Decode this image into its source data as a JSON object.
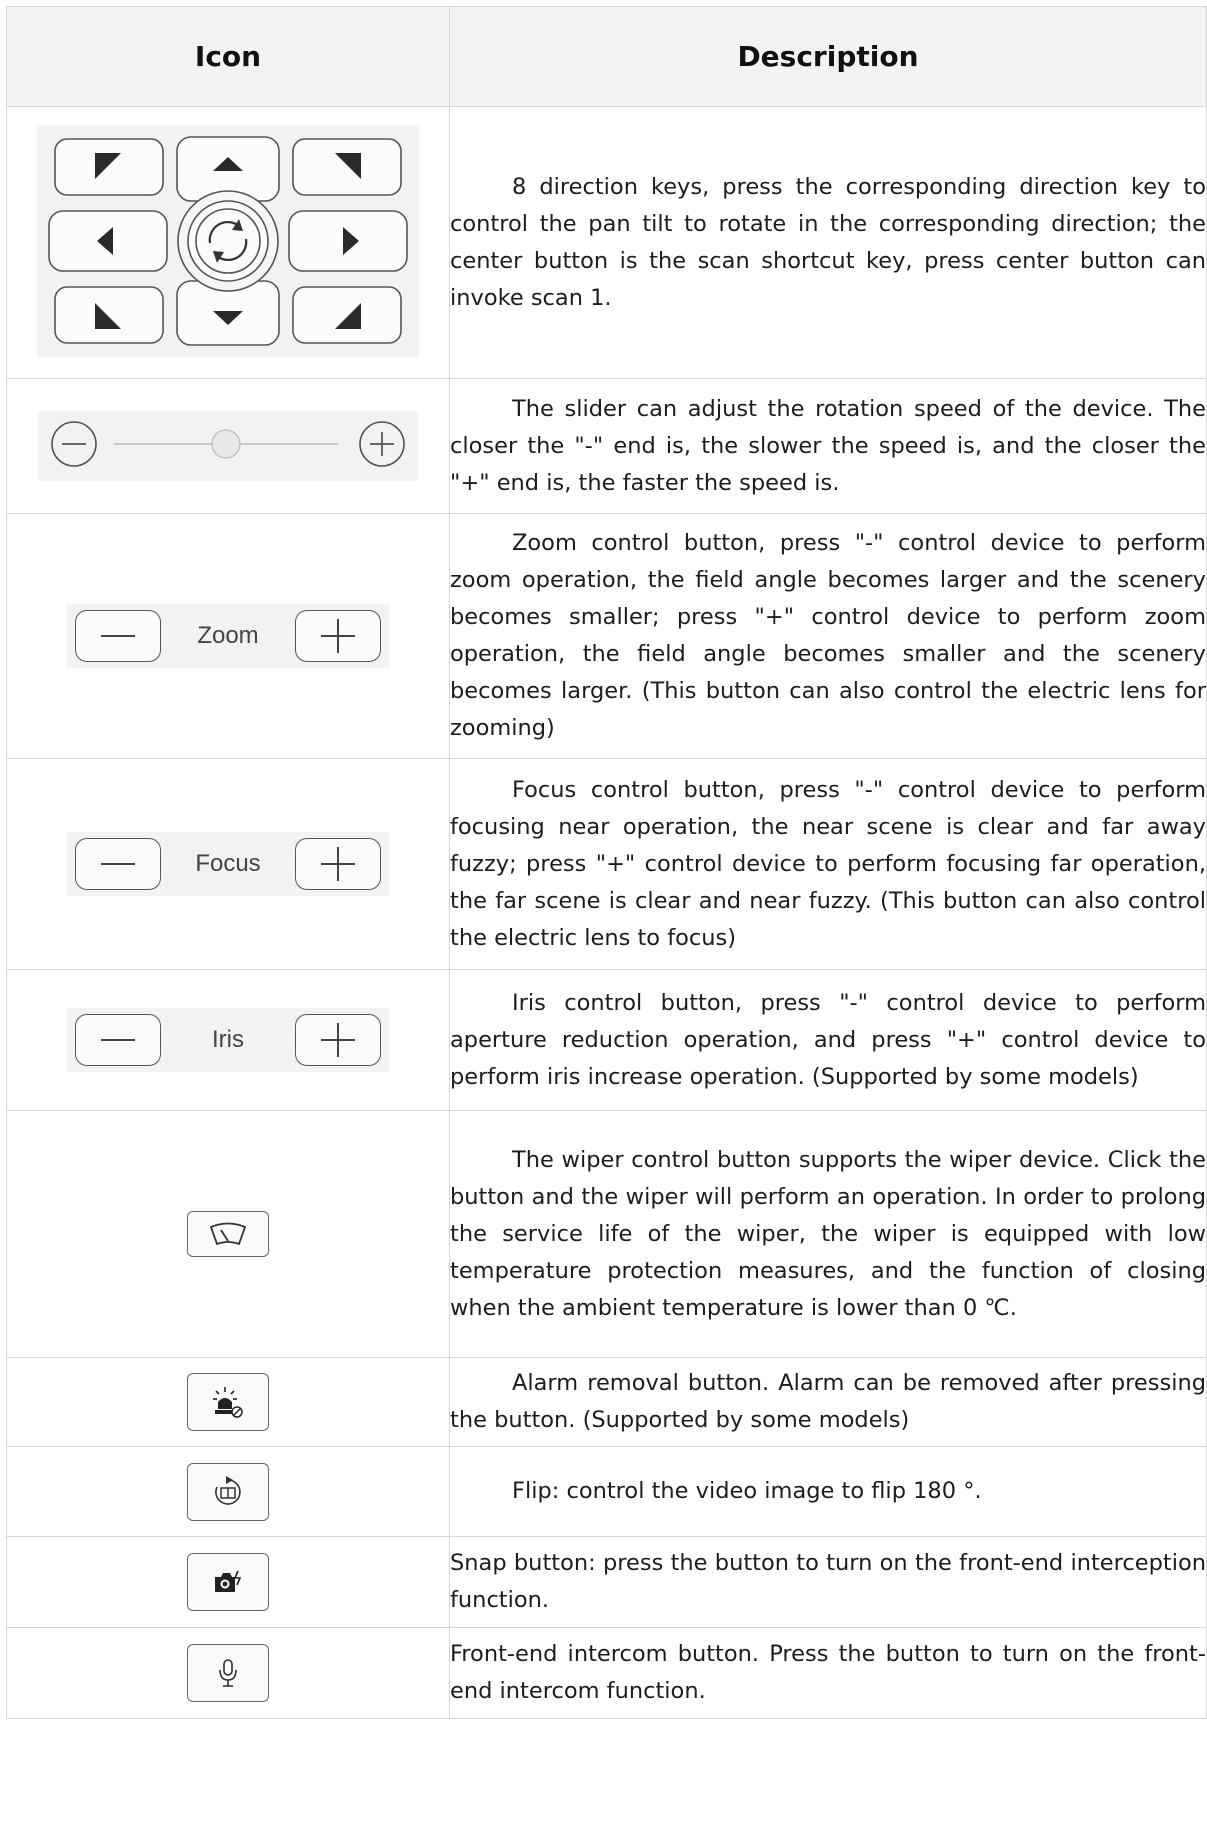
{
  "table": {
    "header": {
      "icon": "Icon",
      "description": "Description"
    },
    "rows": [
      {
        "icon": "direction-pad-icon",
        "description": "8 direction keys, press the corresponding direction key to control the pan tilt to rotate in the corresponding direction; the center button is the scan shortcut key, press center button can invoke scan 1."
      },
      {
        "icon": "speed-slider",
        "slider_level": 0.5,
        "description": "The slider can adjust the rotation speed of the device. The closer the \"-\" end is, the slower the speed is, and the closer the \"+\" end is, the faster the speed is."
      },
      {
        "icon": "zoom-control",
        "label": "Zoom",
        "description": "Zoom control button, press \"-\" control device to perform zoom operation, the field angle becomes larger and the scenery becomes smaller; press \"+\" control device to perform zoom operation, the field angle becomes smaller and the scenery becomes larger. (This button can also control the electric lens for zooming)"
      },
      {
        "icon": "focus-control",
        "label": "Focus",
        "description": "Focus control button, press \"-\" control device to perform focusing near operation, the near scene is clear and far away fuzzy; press \"+\" control device to perform focusing far operation, the far scene is clear and near fuzzy. (This button can also control the electric lens to focus)"
      },
      {
        "icon": "iris-control",
        "label": "Iris",
        "description": "Iris control button, press \"-\" control device to perform aperture reduction operation, and press \"+\" control device to perform iris increase operation. (Supported by some models)"
      },
      {
        "icon": "wiper-icon",
        "description": "The wiper control button supports the wiper device. Click the button and the wiper will perform an operation. In order to prolong the service life of the wiper, the wiper is equipped with low temperature protection measures, and the function of closing when the ambient temperature is lower than 0 ℃."
      },
      {
        "icon": "alarm-clear-icon",
        "description": "Alarm removal button. Alarm can be removed after pressing the button. (Supported by some models)"
      },
      {
        "icon": "flip-icon",
        "description": "Flip: control the video image to flip 180 °."
      },
      {
        "icon": "snap-camera-icon",
        "description": "Snap button: press the button to turn on the front-end interception function."
      },
      {
        "icon": "microphone-icon",
        "description": "Front-end intercom button. Press the button to turn on the front-end intercom function."
      }
    ]
  }
}
